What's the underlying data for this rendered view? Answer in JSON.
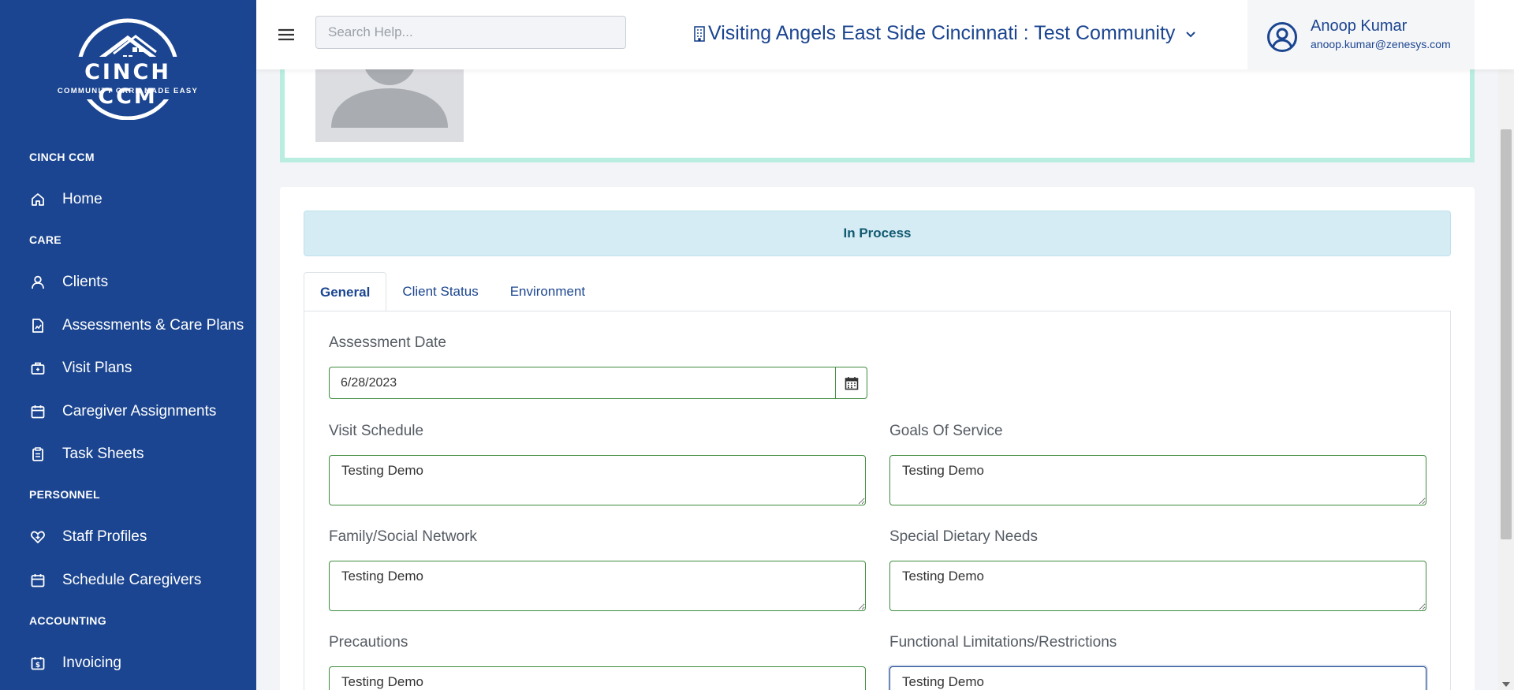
{
  "brand": {
    "name": "CINCH CCM",
    "tagline": "COMMUNITY CARE MADE EASY"
  },
  "sidebar": {
    "sections": [
      {
        "title": "CINCH CCM",
        "items": [
          {
            "label": "Home",
            "icon": "home-icon"
          }
        ]
      },
      {
        "title": "CARE",
        "items": [
          {
            "label": "Clients",
            "icon": "user-icon"
          },
          {
            "label": "Assessments & Care Plans",
            "icon": "document-chart-icon"
          },
          {
            "label": "Visit Plans",
            "icon": "briefcase-icon"
          },
          {
            "label": "Caregiver Assignments",
            "icon": "calendar-icon"
          },
          {
            "label": "Task Sheets",
            "icon": "clipboard-icon"
          }
        ]
      },
      {
        "title": "PERSONNEL",
        "items": [
          {
            "label": "Staff Profiles",
            "icon": "heart-plus-icon"
          },
          {
            "label": "Schedule Caregivers",
            "icon": "calendar-icon"
          }
        ]
      },
      {
        "title": "ACCOUNTING",
        "items": [
          {
            "label": "Invoicing",
            "icon": "invoice-icon"
          }
        ]
      }
    ]
  },
  "header": {
    "search_placeholder": "Search Help...",
    "community": "Visiting Angels East Side Cincinnati : Test Community",
    "user_name": "Anoop Kumar",
    "user_email": "anoop.kumar@zenesys.com"
  },
  "status": {
    "label": "In Process"
  },
  "tabs": [
    {
      "label": "General",
      "active": true
    },
    {
      "label": "Client Status",
      "active": false
    },
    {
      "label": "Environment",
      "active": false
    }
  ],
  "form": {
    "assessment_date_label": "Assessment Date",
    "assessment_date": "6/28/2023",
    "visit_schedule_label": "Visit Schedule",
    "visit_schedule": "Testing Demo",
    "goals_label": "Goals Of Service",
    "goals": "Testing Demo",
    "family_label": "Family/Social Network",
    "family": "Testing Demo",
    "dietary_label": "Special Dietary Needs",
    "dietary": "Testing Demo",
    "precautions_label": "Precautions",
    "precautions": "Testing Demo",
    "limitations_label": "Functional Limitations/Restrictions",
    "limitations": "Testing Demo"
  },
  "colors": {
    "sidebar": "#1b4590",
    "accent_border": "#b9ede0",
    "field_border": "#3d8c3d",
    "status_bg": "#d6ecf4"
  }
}
